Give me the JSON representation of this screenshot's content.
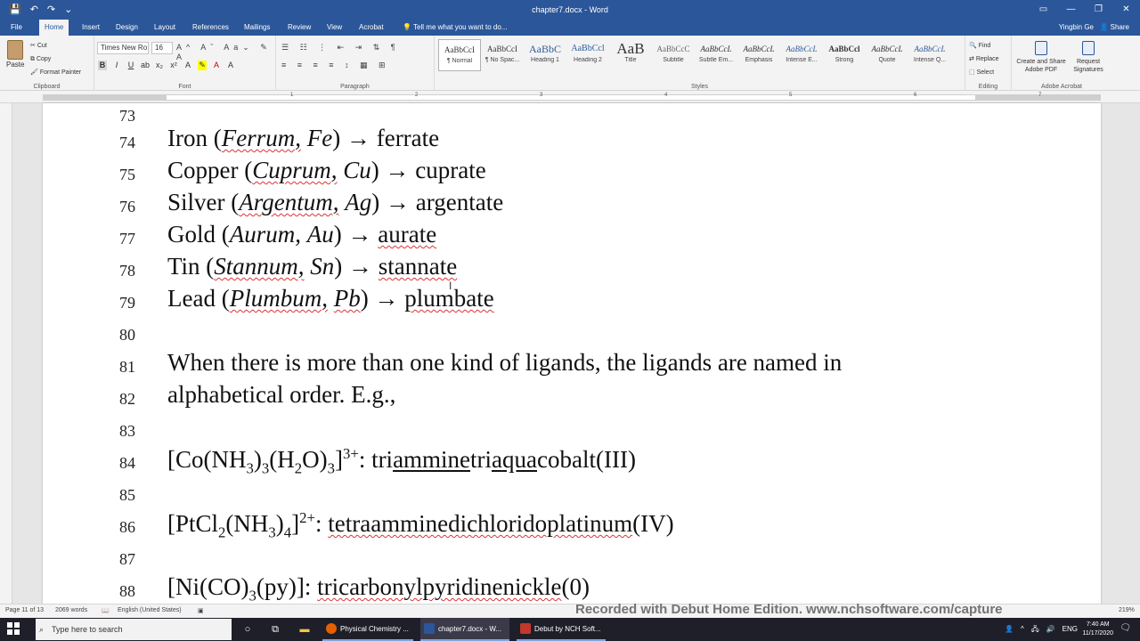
{
  "window": {
    "title": "chapter7.docx - Word",
    "controls": [
      "▭",
      "—",
      "❐",
      "✕"
    ]
  },
  "qat": {
    "save_icon": "save-icon",
    "undo_icon": "undo-icon",
    "redo_icon": "redo-icon",
    "customize_icon": "customize-icon"
  },
  "tabs": [
    "File",
    "Home",
    "Insert",
    "Design",
    "Layout",
    "References",
    "Mailings",
    "Review",
    "View",
    "Acrobat"
  ],
  "active_tab": "Home",
  "tell_me": "Tell me what you want to do...",
  "user": "Yingbin Ge",
  "share": "Share",
  "ribbon": {
    "clipboard": {
      "label": "Clipboard",
      "paste": "Paste",
      "cut": "Cut",
      "copy": "Copy",
      "format_painter": "Format Painter"
    },
    "font": {
      "label": "Font",
      "font_name": "Times New Ro",
      "font_size": "16"
    },
    "paragraph": {
      "label": "Paragraph"
    },
    "styles": {
      "label": "Styles",
      "items": [
        {
          "sample": "AaBbCcI",
          "name": "¶ Normal"
        },
        {
          "sample": "AaBbCcI",
          "name": "¶ No Spac..."
        },
        {
          "sample": "AaBbC",
          "name": "Heading 1"
        },
        {
          "sample": "AaBbCcl",
          "name": "Heading 2"
        },
        {
          "sample": "AaB",
          "name": "Title"
        },
        {
          "sample": "AaBbCcC",
          "name": "Subtitle"
        },
        {
          "sample": "AaBbCcL",
          "name": "Subtle Em..."
        },
        {
          "sample": "AaBbCcL",
          "name": "Emphasis"
        },
        {
          "sample": "AaBbCcL",
          "name": "Intense E..."
        },
        {
          "sample": "AaBbCcl",
          "name": "Strong"
        },
        {
          "sample": "AaBbCcL",
          "name": "Quote"
        },
        {
          "sample": "AaBbCcL",
          "name": "Intense Q..."
        }
      ]
    },
    "editing": {
      "label": "Editing",
      "find": "Find",
      "replace": "Replace",
      "select": "Select"
    },
    "acrobat": {
      "label": "Adobe Acrobat",
      "create_share": "Create and Share Adobe PDF",
      "request_sig": "Request Signatures"
    }
  },
  "ruler_numbers": [
    "1",
    "2",
    "3",
    "4",
    "5",
    "6",
    "7"
  ],
  "document": {
    "lines": [
      {
        "n": "73"
      },
      {
        "n": "74",
        "pre": "Iron (",
        "it1": "Ferrum,",
        "it2": "Fe",
        "post": ") ",
        "arrow": "→",
        "result": "ferrate"
      },
      {
        "n": "75",
        "pre": "Copper (",
        "it1": "Cuprum,",
        "it2": "Cu",
        "post": ") ",
        "arrow": "→",
        "result": "cuprate"
      },
      {
        "n": "76",
        "pre": "Silver (",
        "it1": "Argentum,",
        "it2": "Ag",
        "post": ") ",
        "arrow": "→",
        "result": "argentate"
      },
      {
        "n": "77",
        "pre": "Gold (",
        "it1": "Aurum,",
        "it2": "Au",
        "post": ") ",
        "arrow": "→",
        "result": "aurate"
      },
      {
        "n": "78",
        "pre": "Tin (",
        "it1": "Stannum,",
        "it2": "Sn",
        "post": ") ",
        "arrow": "→",
        "result": "stannate"
      },
      {
        "n": "79",
        "pre": "Lead (",
        "it1": "Plumbum,",
        "it2": "Pb",
        "post": ") ",
        "arrow": "→",
        "result": "plumbate"
      },
      {
        "n": "80"
      },
      {
        "n": "81",
        "text": "When there is more than one kind of ligands, the ligands are named in"
      },
      {
        "n": "82",
        "text": "alphabetical order. E.g.,"
      },
      {
        "n": "83"
      },
      {
        "n": "84"
      },
      {
        "n": "85"
      },
      {
        "n": "86"
      },
      {
        "n": "87"
      },
      {
        "n": "88"
      }
    ],
    "formula84": {
      "a": "[Co(NH",
      "s1": "3",
      "b": ")",
      "s2": "3",
      "c": "(H",
      "s3": "2",
      "d": "O)",
      "s4": "3",
      "e": "]",
      "sup": "3+",
      "f": ": tri",
      "g": "ammine",
      "h": "tri",
      "i": "aqua",
      "j": "cobalt(III)"
    },
    "formula86": {
      "a": "[PtCl",
      "s1": "2",
      "b": "(NH",
      "s2": "3",
      "c": ")",
      "s3": "4",
      "d": "]",
      "sup": "2+",
      "e": ": ",
      "f": "tetraamminedichloridoplatinum",
      "g": "(IV)"
    },
    "formula88": {
      "a": "[Ni(CO)",
      "s1": "3",
      "b": "(py)]: ",
      "c": "tricarbonylpyridinenickle",
      "d": "(0)"
    }
  },
  "status": {
    "page": "Page 11 of 13",
    "words": "2069 words",
    "language": "English (United States)",
    "zoom": "219%"
  },
  "watermark": "Recorded with Debut Home Edition. www.nchsoftware.com/capture",
  "taskbar": {
    "search_placeholder": "Type here to search",
    "apps": [
      "Physical Chemistry ...",
      "chapter7.docx - W...",
      "Debut by NCH Soft..."
    ],
    "language": "ENG",
    "time": "7:40 AM",
    "date": "11/17/2020"
  }
}
